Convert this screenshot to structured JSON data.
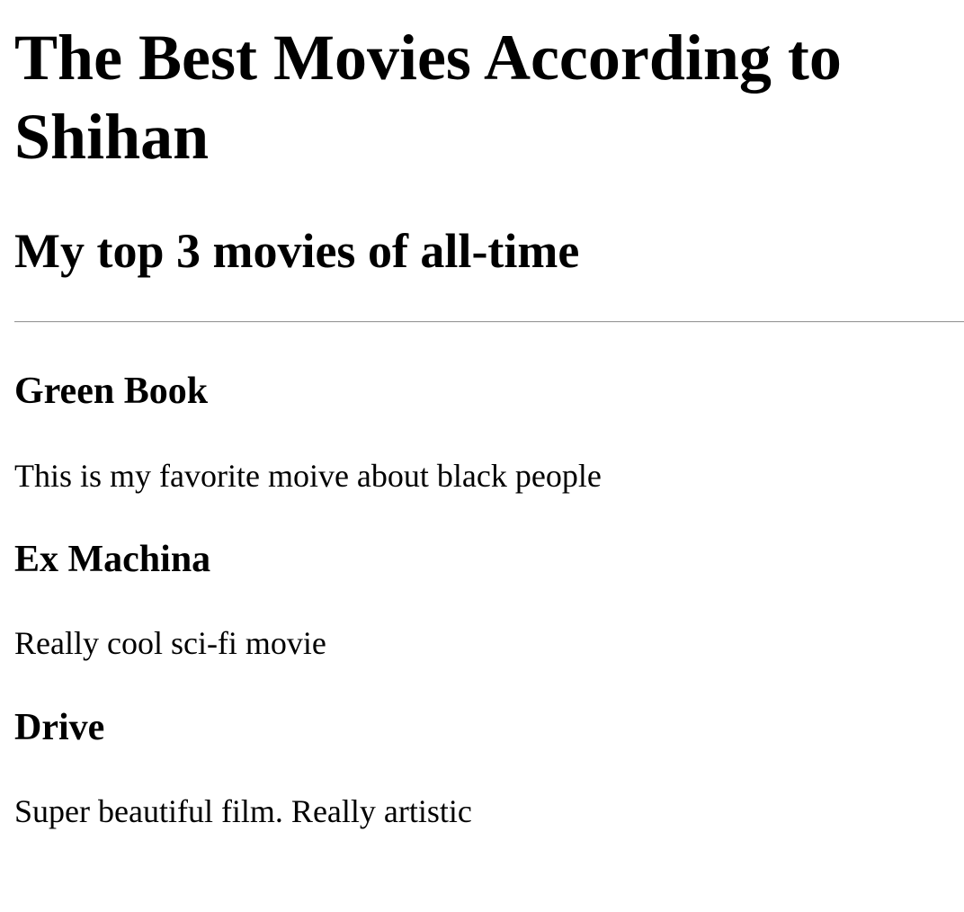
{
  "page": {
    "title": "The Best Movies According to Shihan",
    "subtitle": "My top 3 movies of all-time"
  },
  "movies": [
    {
      "title": "Green Book",
      "description": "This is my favorite moive about black people"
    },
    {
      "title": "Ex Machina",
      "description": "Really cool sci-fi movie"
    },
    {
      "title": "Drive",
      "description": "Super beautiful film. Really artistic"
    }
  ]
}
